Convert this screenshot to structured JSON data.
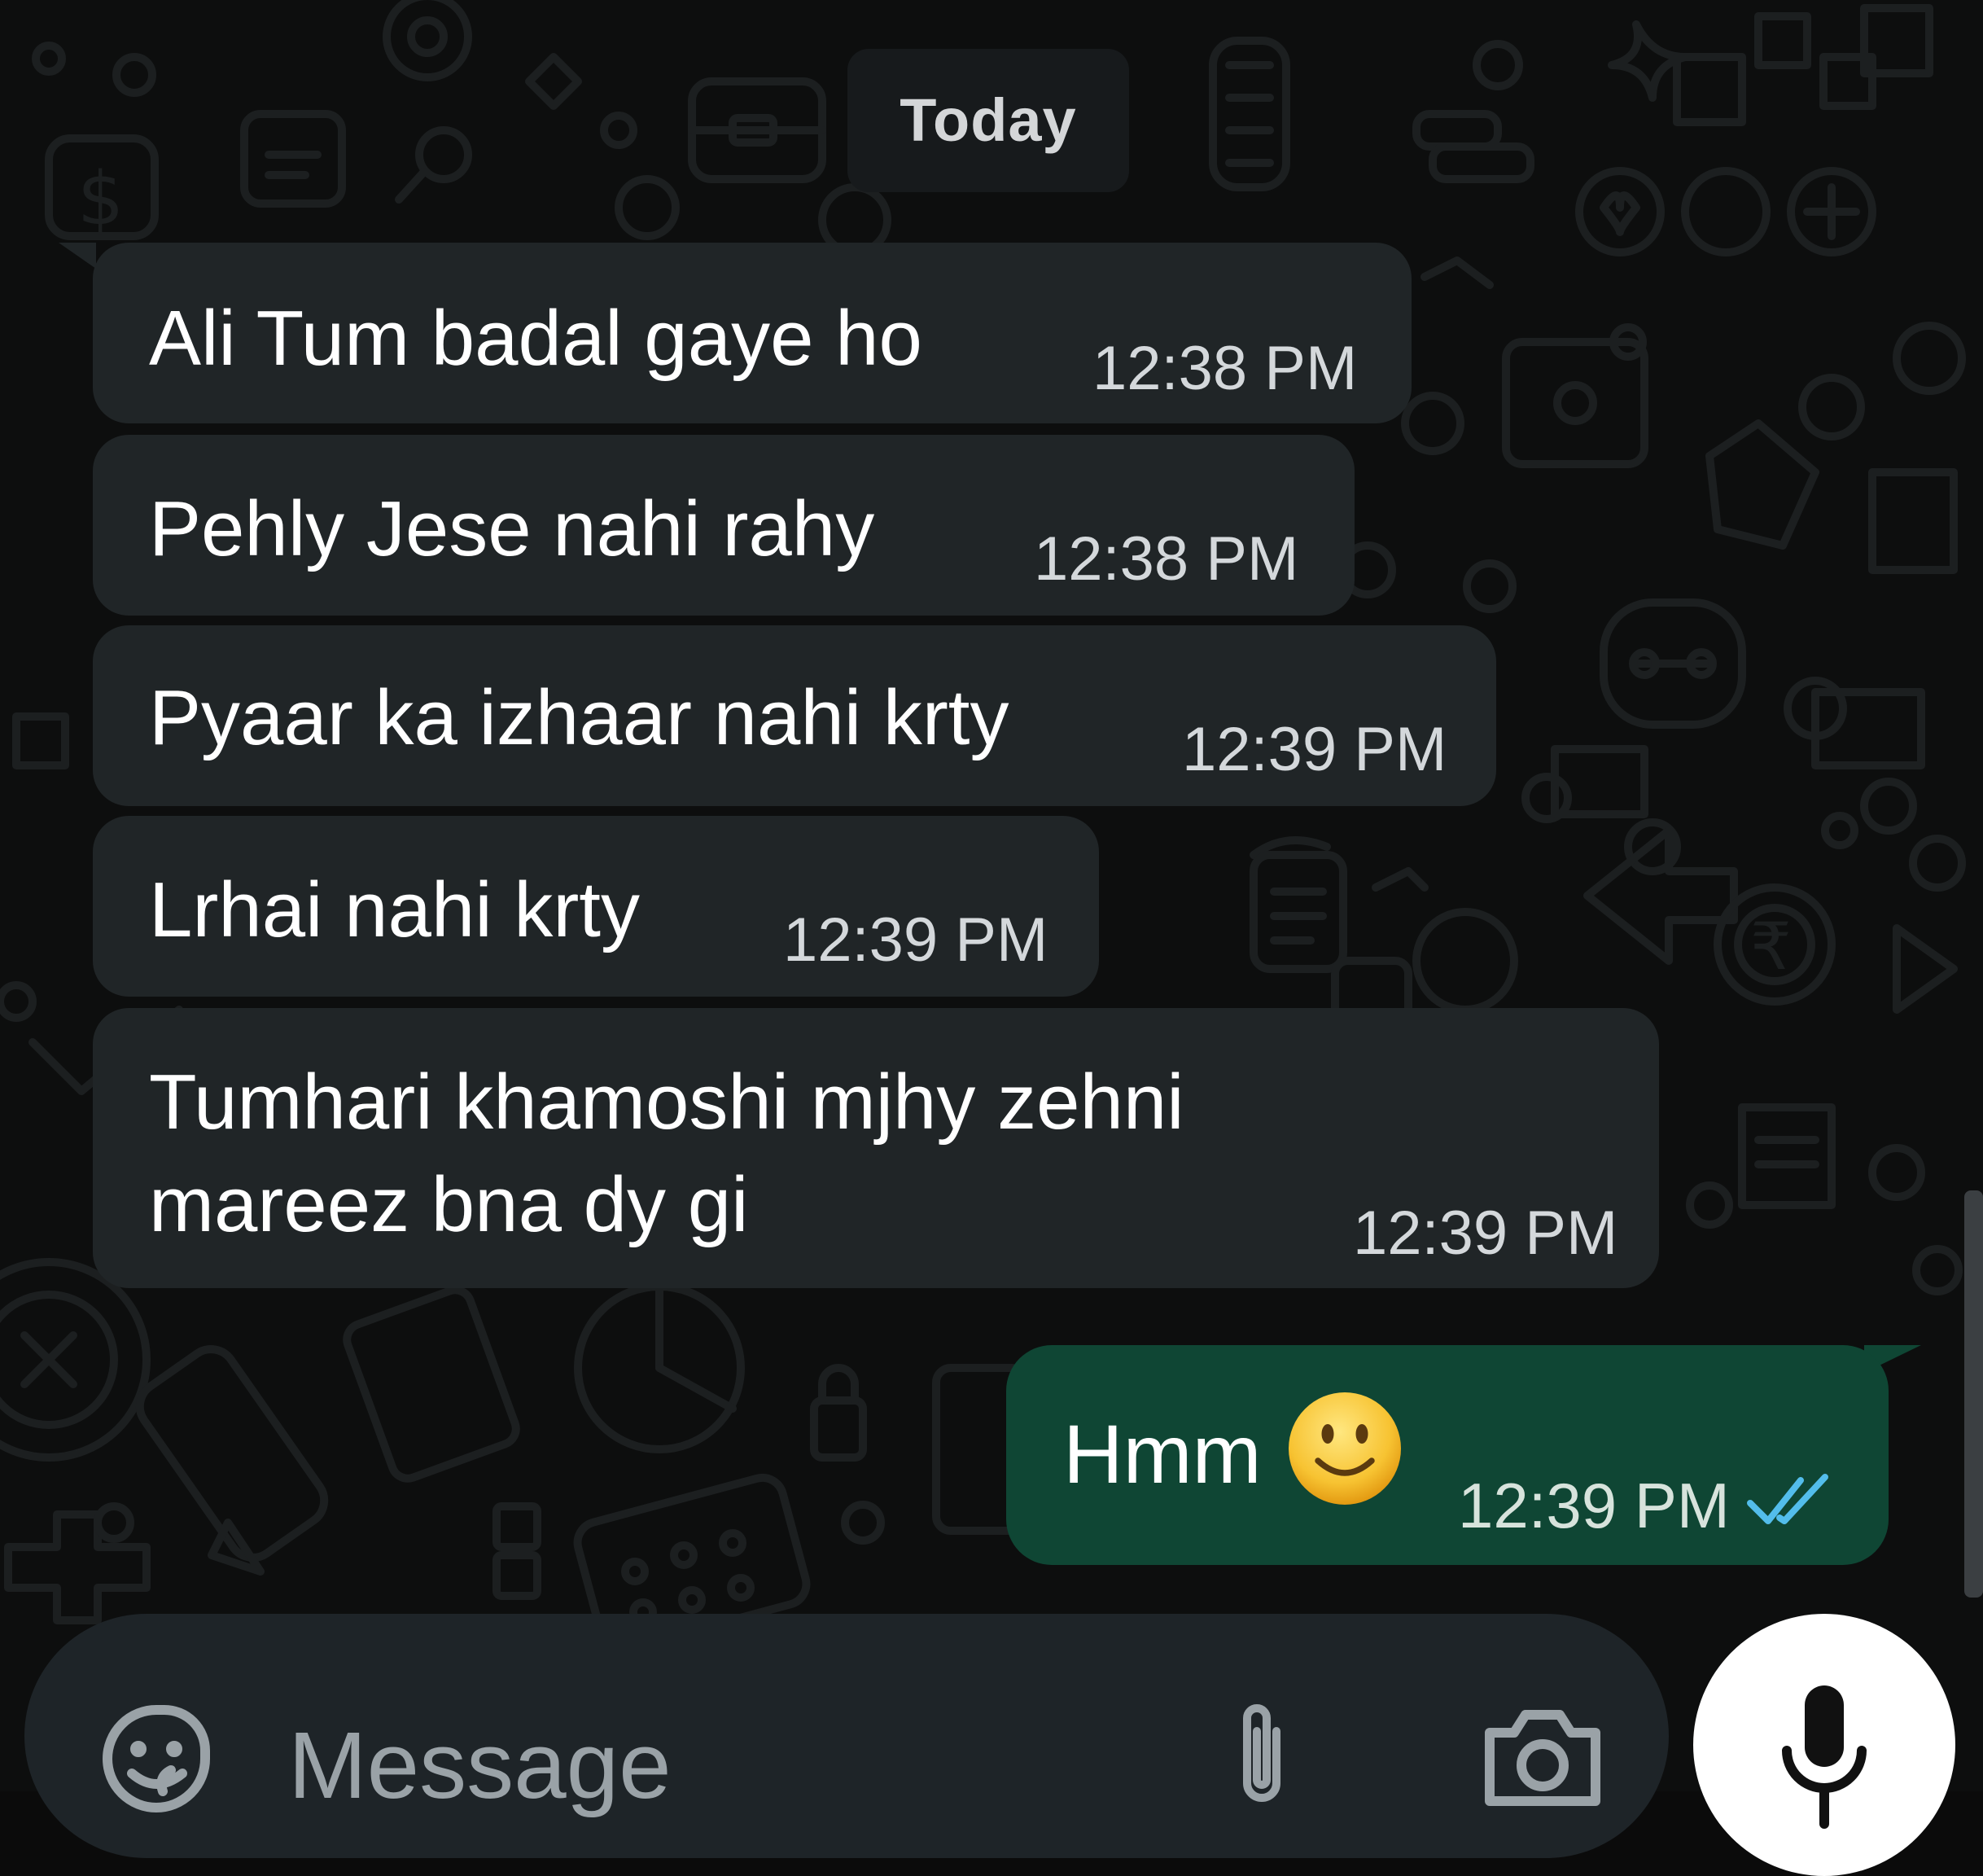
{
  "date_separator": "Today",
  "messages": [
    {
      "direction": "incoming",
      "text": "Ali Tum badal gaye ho",
      "time": "12:38 PM"
    },
    {
      "direction": "incoming",
      "text": "Pehly Jese nahi rahy",
      "time": "12:38 PM"
    },
    {
      "direction": "incoming",
      "text": "Pyaar ka izhaar nahi krty",
      "time": "12:39 PM"
    },
    {
      "direction": "incoming",
      "text": "Lrhai nahi krty",
      "time": "12:39 PM"
    },
    {
      "direction": "incoming",
      "text_line1": "Tumhari khamoshi mjhy zehni",
      "text_line2": "mareez bna dy gi",
      "time": "12:39 PM"
    },
    {
      "direction": "outgoing",
      "text": "Hmm",
      "emoji": "slightly-smiling-face",
      "time": "12:39 PM",
      "status": "read"
    }
  ],
  "composer": {
    "placeholder": "Message",
    "icons": [
      "sticker-icon",
      "attach-icon",
      "camera-icon",
      "mic-icon"
    ]
  },
  "colors": {
    "background": "#0d0e0e",
    "incoming_bubble": "#202527",
    "outgoing_bubble": "#0f4634",
    "read_ticks": "#53bdeb",
    "composer": "#1e2428"
  }
}
